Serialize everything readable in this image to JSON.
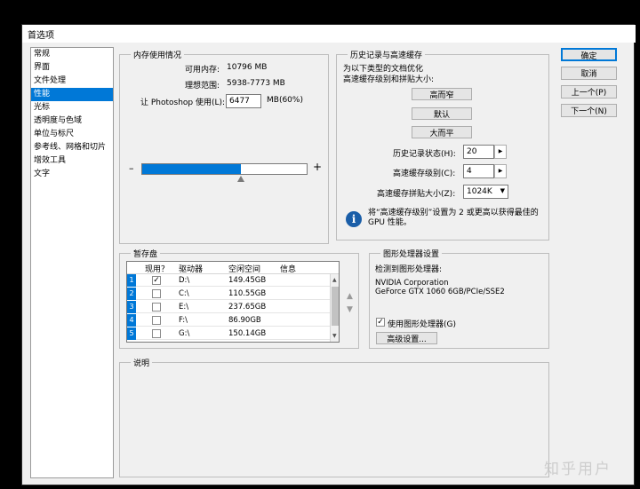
{
  "window": {
    "title": "首选项"
  },
  "categories": [
    {
      "label": "常规",
      "selected": false
    },
    {
      "label": "界面",
      "selected": false
    },
    {
      "label": "文件处理",
      "selected": false
    },
    {
      "label": "性能",
      "selected": true
    },
    {
      "label": "光标",
      "selected": false
    },
    {
      "label": "透明度与色域",
      "selected": false
    },
    {
      "label": "单位与标尺",
      "selected": false
    },
    {
      "label": "参考线、网格和切片",
      "selected": false
    },
    {
      "label": "增效工具",
      "selected": false
    },
    {
      "label": "文字",
      "selected": false
    }
  ],
  "memory": {
    "title": "内存使用情况",
    "available_label": "可用内存:",
    "available_value": "10796 MB",
    "ideal_label": "理想范围:",
    "ideal_value": "5938-7773 MB",
    "let_label": "让 Photoshop 使用(L):",
    "let_value": "6477",
    "let_suffix": "MB(60%)",
    "slider_fraction": 0.6,
    "minus": "–",
    "plus": "+"
  },
  "history": {
    "title": "历史记录与高速缓存",
    "desc_line1": "为以下类型的文档优化",
    "desc_line2": "高速缓存级别和拼贴大小:",
    "btn_tall_thin": "高而窄",
    "btn_default": "默认",
    "btn_big_flat": "大而平",
    "states_label": "历史记录状态(H):",
    "states_value": "20",
    "cache_levels_label": "高速缓存级别(C):",
    "cache_levels_value": "4",
    "tile_size_label": "高速缓存拼贴大小(Z):",
    "tile_size_value": "1024K",
    "info_text_line1": "将“高速缓存级别”设置为 2 或更高以获得最佳的",
    "info_text_line2": "GPU 性能。",
    "info_icon_glyph": "i"
  },
  "scratch": {
    "title": "暂存盘",
    "columns": [
      "现用？",
      "驱动器",
      "空闲空间",
      "信息"
    ],
    "rows": [
      {
        "num": "1",
        "active": true,
        "drive": "D:\\",
        "free": "149.45GB",
        "info": ""
      },
      {
        "num": "2",
        "active": false,
        "drive": "C:\\",
        "free": "110.55GB",
        "info": ""
      },
      {
        "num": "3",
        "active": false,
        "drive": "E:\\",
        "free": "237.65GB",
        "info": ""
      },
      {
        "num": "4",
        "active": false,
        "drive": "F:\\",
        "free": "86.90GB",
        "info": ""
      },
      {
        "num": "5",
        "active": false,
        "drive": "G:\\",
        "free": "150.14GB",
        "info": ""
      }
    ],
    "check_glyph": "✓",
    "up_glyph": "▲",
    "down_glyph": "▼"
  },
  "gpu": {
    "title": "图形处理器设置",
    "detected_label": "检测到图形处理器:",
    "vendor": "NVIDIA Corporation",
    "model": "GeForce GTX 1060 6GB/PCIe/SSE2",
    "use_gpu_label": "使用图形处理器(G)",
    "use_gpu_checked": true,
    "advanced_btn": "高级设置..."
  },
  "description": {
    "title": "说明"
  },
  "actions": {
    "ok": "确定",
    "cancel": "取消",
    "prev": "上一个(P)",
    "next": "下一个(N)"
  },
  "watermark": "知乎用户"
}
